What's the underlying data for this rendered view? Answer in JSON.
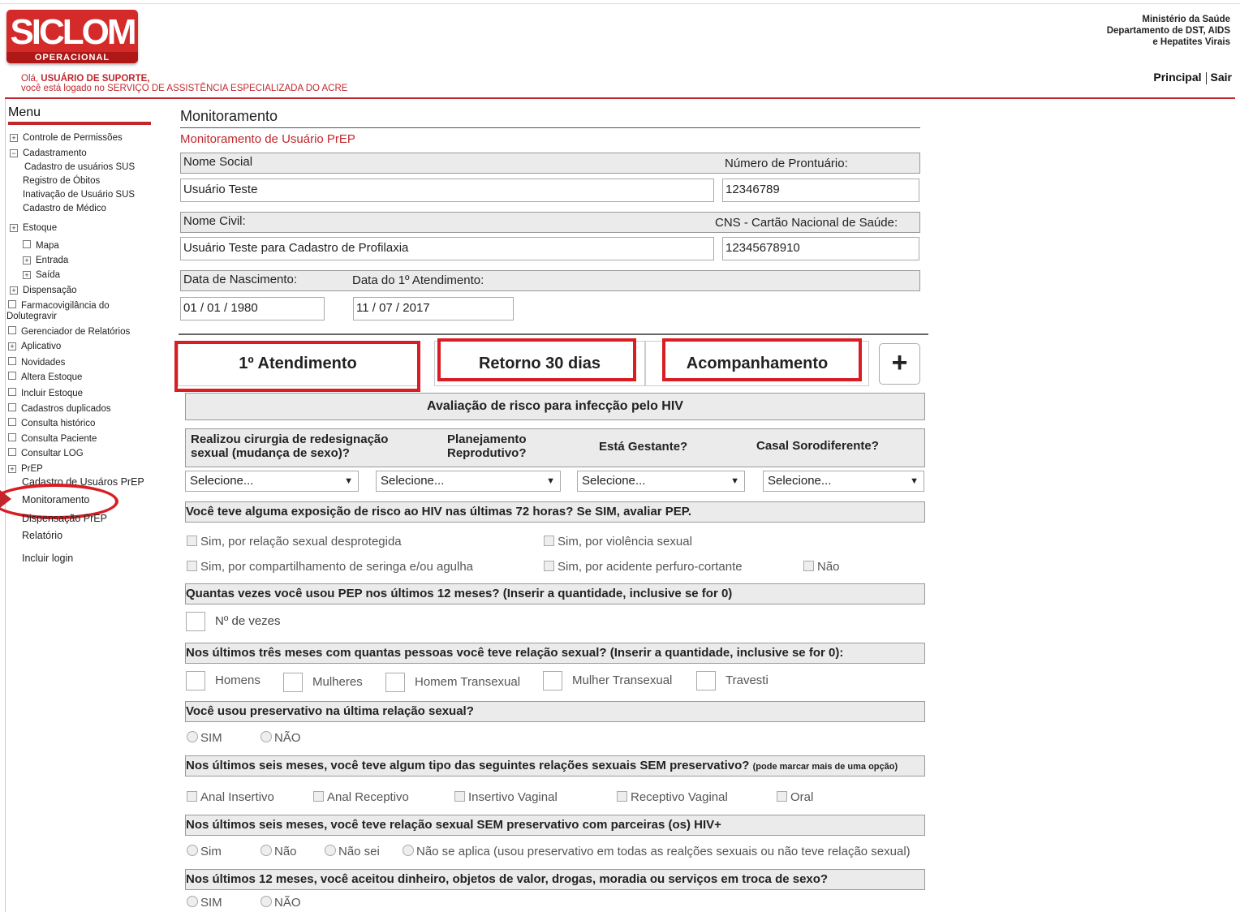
{
  "header": {
    "logo_text": "SICLOM",
    "logo_sub": "OPERACIONAL",
    "greeting_prefix": "Olá,",
    "user_name": "USUÁRIO DE SUPORTE,",
    "service_line": "você está logado no SERVIÇO DE ASSISTÊNCIA ESPECIALIZADA DO ACRE",
    "ministry_lines": [
      "Ministério da Saúde",
      "Departamento de DST, AIDS",
      "e Hepatites Virais"
    ],
    "link_principal": "Principal",
    "link_sair": "Sair"
  },
  "sidebar": {
    "title": "Menu",
    "items": [
      {
        "label": "Controle de Permissões",
        "box": "+"
      },
      {
        "label": "Cadastramento",
        "box": "−"
      },
      {
        "label": "Cadastro de usuários SUS",
        "box": ""
      },
      {
        "label": "Registro de Óbitos",
        "box": ""
      },
      {
        "label": "Inativação de Usuário SUS",
        "box": ""
      },
      {
        "label": "Cadastro de Médico",
        "box": ""
      },
      {
        "label": "Estoque",
        "box": "+"
      },
      {
        "label": "Mapa",
        "box": " "
      },
      {
        "label": "Entrada",
        "box": "+"
      },
      {
        "label": "Saída",
        "box": "+"
      },
      {
        "label": "Dispensação",
        "box": "+"
      },
      {
        "label": "Farmacovigilância do",
        "box": " "
      },
      {
        "label": "Dolutegravir",
        "box": ""
      },
      {
        "label": "Gerenciador de Relatórios",
        "box": " "
      },
      {
        "label": "Aplicativo",
        "box": "+"
      },
      {
        "label": "Novidades",
        "box": " "
      },
      {
        "label": "Altera Estoque",
        "box": " "
      },
      {
        "label": "Incluir Estoque",
        "box": " "
      },
      {
        "label": "Cadastros duplicados",
        "box": " "
      },
      {
        "label": "Consulta histórico",
        "box": " "
      },
      {
        "label": "Consulta Paciente",
        "box": " "
      },
      {
        "label": "Consultar LOG",
        "box": " "
      },
      {
        "label": "PrEP",
        "box": "+"
      },
      {
        "label": "Cadastro de Usuáros PrEP",
        "box": ""
      },
      {
        "label": "Monitoramento",
        "box": ""
      },
      {
        "label": "Dispensação PrEP",
        "box": ""
      },
      {
        "label": "Relatório",
        "box": ""
      },
      {
        "label": "Incluir login",
        "box": ""
      }
    ]
  },
  "main": {
    "title": "Monitoramento",
    "subtitle": "Monitoramento de Usuário PrEP",
    "nome_social_label": "Nome Social",
    "prontuario_label": "Número de Prontuário:",
    "nome_social_value": "Usuário Teste",
    "prontuario_value": "12346789",
    "nome_civil_label": "Nome Civil:",
    "cns_label": "CNS - Cartão Nacional de Saúde:",
    "nome_civil_value": "Usuário Teste para Cadastro de Profilaxia",
    "cns_value": "12345678910",
    "nascimento_label": "Data de Nascimento:",
    "atendimento_label": "Data do 1º Atendimento:",
    "nascimento_value": "01 / 01 / 1980",
    "atendimento_value": "11 / 07 / 2017",
    "tabs": [
      "1º Atendimento",
      "Retorno 30 dias",
      "Acompanhamento"
    ],
    "plus_label": "+",
    "section_title": "Avaliação de risco para infecção pelo HIV",
    "q_cirurgia": "Realizou cirurgia de redesignação sexual (mudança de sexo)?",
    "q_planejamento": "Planejamento Reprodutivo?",
    "q_gestante": "Está Gestante?",
    "q_casal": "Casal Sorodiferente?",
    "select_placeholder": "Selecione...",
    "q_exposicao": "Você teve alguma exposição de risco ao HIV nas últimas 72 horas? Se SIM, avaliar PEP.",
    "exp_opts": [
      "Sim, por relação sexual desprotegida",
      "Sim, por violência sexual",
      "Sim, por compartilhamento de seringa e/ou agulha",
      "Sim, por acidente perfuro-cortante",
      "Não"
    ],
    "q_pep": "Quantas vezes você usou PEP nos últimos 12 meses? (Inserir a quantidade, inclusive se for 0)",
    "pep_count_label": "Nº de vezes",
    "q_pessoas": "Nos últimos três meses com quantas pessoas você teve relação sexual? (Inserir a quantidade, inclusive se for 0):",
    "pessoas_opts": [
      "Homens",
      "Mulheres",
      "Homem Transexual",
      "Mulher Transexual",
      "Travesti"
    ],
    "q_preservativo": "Você usou preservativo na última relação sexual?",
    "preservativo_opts": [
      "SIM",
      "NÃO"
    ],
    "q_relacoes": "Nos últimos seis meses, você teve algum tipo das seguintes relações sexuais SEM preservativo?",
    "q_relacoes_note": "(pode marcar mais de uma opção)",
    "relacoes_opts": [
      "Anal Insertivo",
      "Anal Receptivo",
      "Insertivo Vaginal",
      "Receptivo Vaginal",
      "Oral"
    ],
    "q_hiv": "Nos últimos seis meses, você teve relação sexual SEM preservativo com parceiras (os) HIV+",
    "hiv_opts": [
      "Sim",
      "Não",
      "Não sei",
      "Não se aplica (usou preservativo em todas as realções sexuais ou não teve relação sexual)"
    ],
    "q_dinheiro": "Nos últimos 12 meses, você aceitou dinheiro, objetos de valor, drogas, moradia ou serviços em troca de sexo?",
    "dinheiro_opts": [
      "SIM",
      "NÃO"
    ]
  },
  "colors": {
    "brand_red": "#c0282d",
    "highlight_red": "#d81d24",
    "bar_gray": "#ebebeb"
  }
}
